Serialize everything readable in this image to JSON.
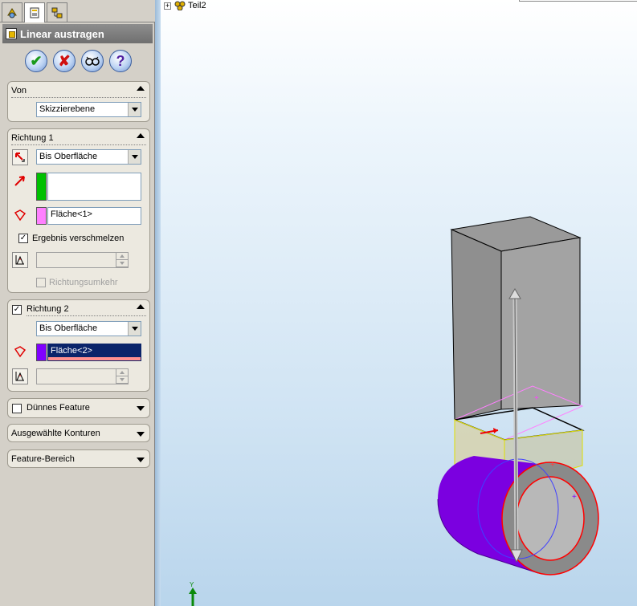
{
  "feature": {
    "title": "Linear austragen"
  },
  "tree": {
    "part_name": "Teil2"
  },
  "groups": {
    "von": {
      "title": "Von",
      "combo_value": "Skizzierebene"
    },
    "richtung1": {
      "title": "Richtung 1",
      "end_condition": "Bis Oberfläche",
      "face_value": "Fläche<1>",
      "merge_label": "Ergebnis verschmelzen",
      "merge_checked": true,
      "reverse_label": "Richtungsumkehr",
      "reverse_checked": false
    },
    "richtung2": {
      "title": "Richtung 2",
      "checked": true,
      "end_condition": "Bis Oberfläche",
      "face_value": "Fläche<2>"
    },
    "duennes_feature": {
      "title": "Dünnes Feature",
      "checked": false
    },
    "ausgewaehlte_konturen": {
      "title": "Ausgewählte Konturen"
    },
    "feature_bereich": {
      "title": "Feature-Bereich"
    }
  },
  "colors": {
    "richtung1_swatch": "#00c000",
    "face1_swatch": "#ff80ff",
    "face2_swatch": "#8000ff",
    "selected_field_bg": "#0a246a",
    "cylinder": "#7b00e0",
    "box": "#8c8c8c"
  },
  "axis": {
    "y_label": "Y"
  }
}
